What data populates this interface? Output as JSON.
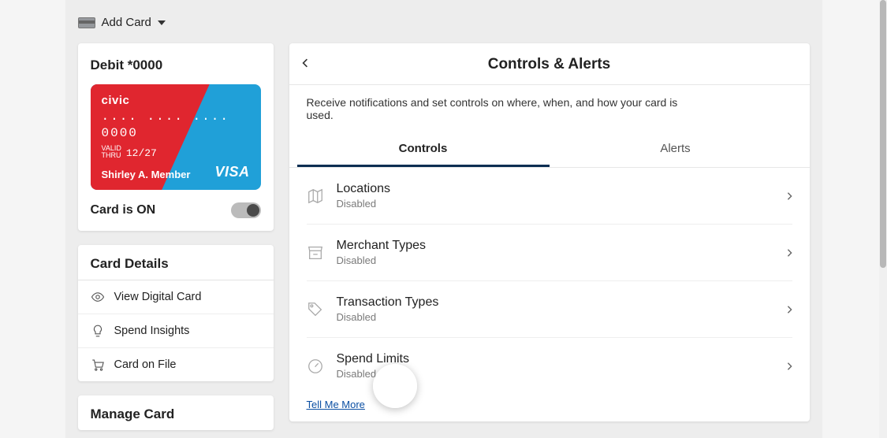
{
  "header": {
    "add_card_label": "Add Card"
  },
  "card": {
    "title": "Debit *0000",
    "brand": "civic",
    "number_mask": "···· ···· ···· 0000",
    "valid_label": "VALID\nTHRU",
    "valid_date": "12/27",
    "holder": "Shirley A. Member",
    "network": "VISA",
    "status_label": "Card is ON",
    "status_on": true
  },
  "details": {
    "heading": "Card Details",
    "items": [
      {
        "id": "view-digital",
        "label": "View Digital Card",
        "icon": "eye-icon"
      },
      {
        "id": "spend-insights",
        "label": "Spend Insights",
        "icon": "bulb-icon"
      },
      {
        "id": "card-on-file",
        "label": "Card on File",
        "icon": "cart-icon"
      }
    ]
  },
  "manage": {
    "heading": "Manage Card"
  },
  "main": {
    "title": "Controls & Alerts",
    "subtext": "Receive notifications and set controls on where, when, and how your card is used.",
    "tabs": [
      {
        "id": "controls",
        "label": "Controls",
        "active": true
      },
      {
        "id": "alerts",
        "label": "Alerts",
        "active": false
      }
    ],
    "controls": [
      {
        "id": "locations",
        "label": "Locations",
        "status": "Disabled",
        "icon": "map-icon"
      },
      {
        "id": "merchant-types",
        "label": "Merchant Types",
        "status": "Disabled",
        "icon": "store-icon"
      },
      {
        "id": "txn-types",
        "label": "Transaction Types",
        "status": "Disabled",
        "icon": "tag-icon"
      },
      {
        "id": "spend-limits",
        "label": "Spend Limits",
        "status": "Disabled",
        "icon": "gauge-icon"
      }
    ],
    "tell_more": "Tell Me More"
  }
}
